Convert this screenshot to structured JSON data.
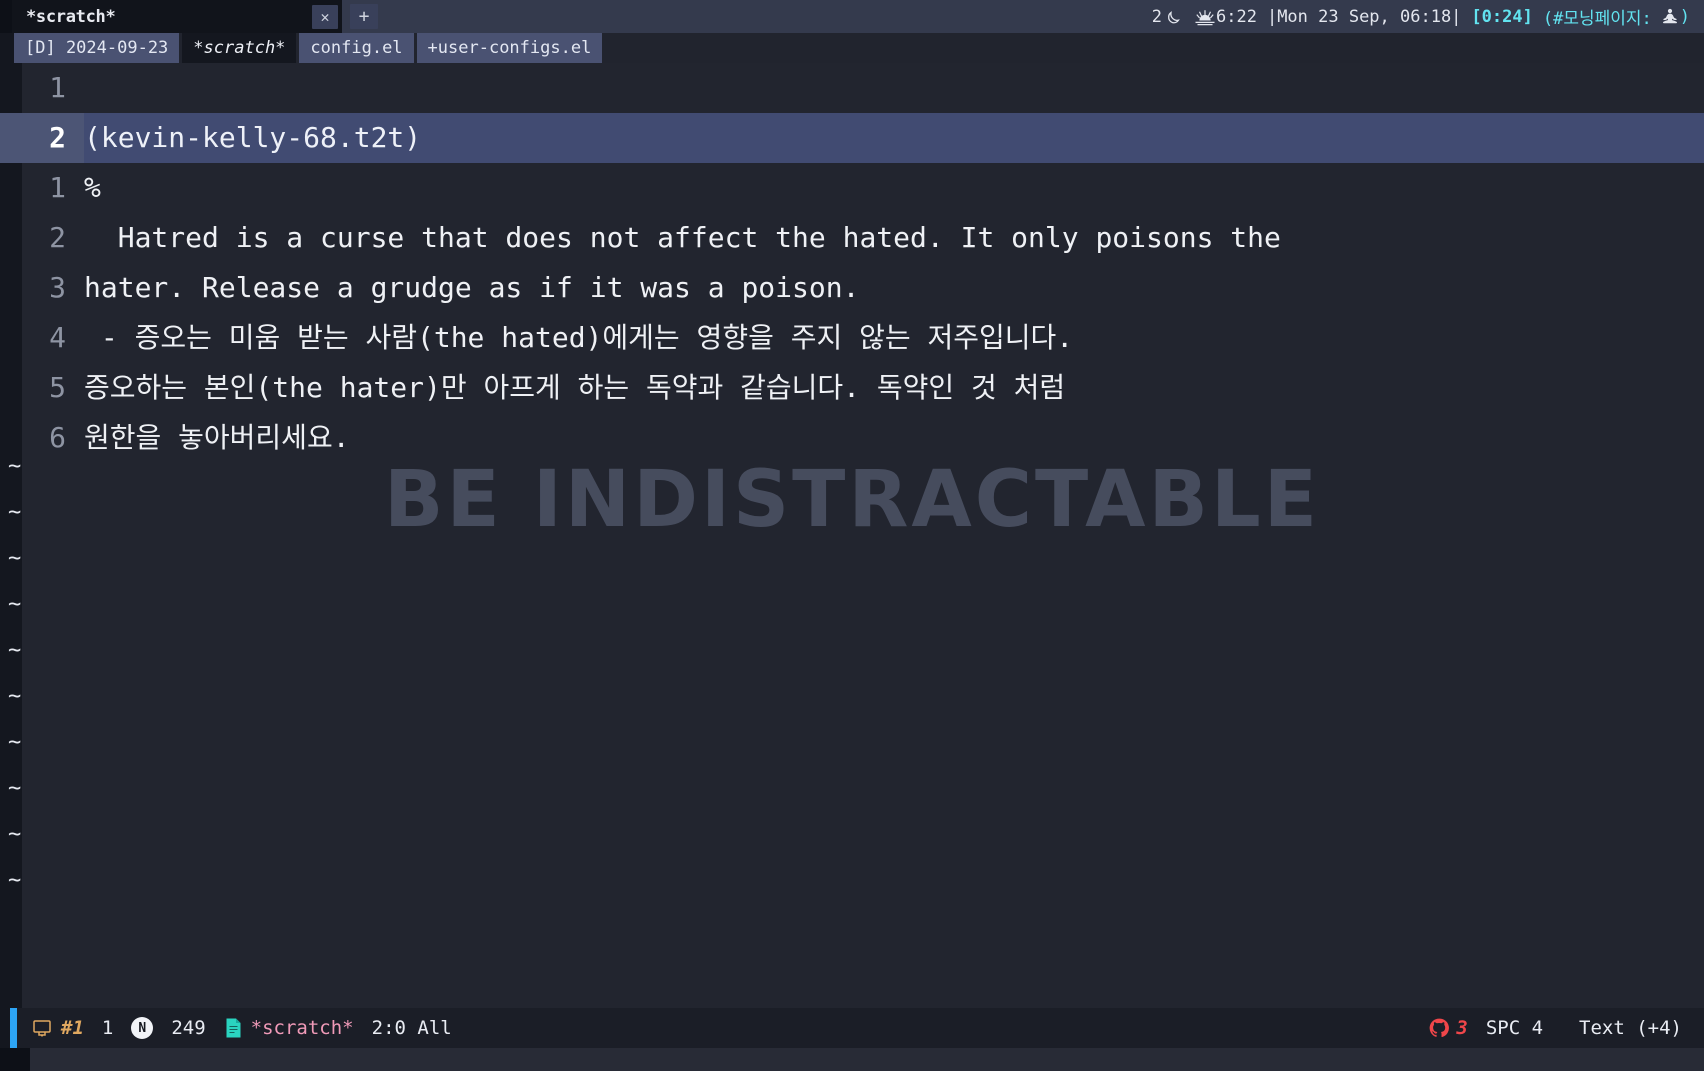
{
  "titlebar": {
    "window_tab": {
      "label": "*scratch*",
      "close_icon": "close-icon",
      "new_tab_icon": "plus-icon"
    },
    "status": {
      "moon_count": "2",
      "moon_icon": "crescent-moon-icon",
      "sunrise_icon": "sunrise-icon",
      "sunrise_time": "6:22",
      "datetime": "|Mon 23 Sep, 06:18|",
      "timer": "[0:24]",
      "task": "(#모닝페이지:",
      "task_icon": "meditation-person-icon",
      "task_close": ")",
      "accent_cyan": "#62e3f0"
    }
  },
  "tabbar": {
    "tabs": [
      {
        "label": "[D] 2024-09-23",
        "active": false
      },
      {
        "label": "*scratch*",
        "active": true
      },
      {
        "label": "config.el",
        "active": false
      },
      {
        "label": "+user-configs.el",
        "active": false
      }
    ]
  },
  "editor": {
    "lines": [
      {
        "num": "1",
        "text": "",
        "current": false
      },
      {
        "num": "2",
        "text": "(kevin-kelly-68.t2t)",
        "current": true
      },
      {
        "num": "1",
        "text": "%",
        "current": false
      },
      {
        "num": "2",
        "text": "  Hatred is a curse that does not affect the hated. It only poisons the",
        "current": false
      },
      {
        "num": "3",
        "text": "hater. Release a grudge as if it was a poison.",
        "current": false
      },
      {
        "num": "4",
        "text": " - 증오는 미움 받는 사람(the hated)에게는 영향을 주지 않는 저주입니다.",
        "current": false
      },
      {
        "num": "5",
        "text": "증오하는 본인(the hater)만 아프게 하는 독약과 같습니다. 독약인 것 처럼",
        "current": false
      },
      {
        "num": "6",
        "text": "원한을 놓아버리세요.",
        "current": false
      }
    ],
    "tilde": "~",
    "tilde_count": 10,
    "watermark": "BE INDISTRACTABLE"
  },
  "modeline": {
    "left": {
      "workspace_icon": "workspace-icon",
      "workspace": "#1",
      "window_number": "1",
      "mode_badge": "N",
      "char_count": "249",
      "buffer_icon": "file-icon",
      "buffer_name": "*scratch*",
      "position": "2:0 All"
    },
    "right": {
      "vcs_icon": "github-icon",
      "vcs_count": "3",
      "indentation": "SPC 4",
      "major_mode": "Text (+4)"
    }
  }
}
